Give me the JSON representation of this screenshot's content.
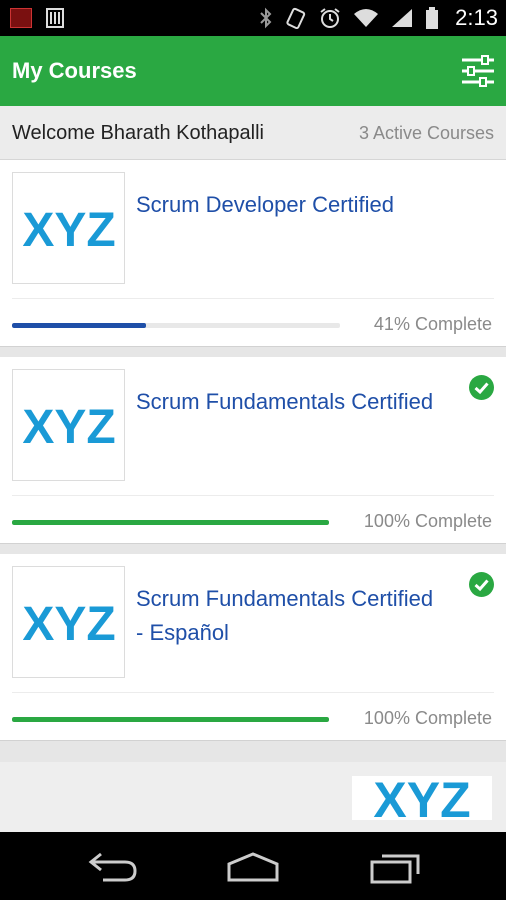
{
  "status_bar": {
    "time": "2:13",
    "left_icons": [
      "app-notification-icon",
      "barcode-notification-icon"
    ],
    "right_icons": [
      "bluetooth-icon",
      "vibrate-icon",
      "alarm-icon",
      "wifi-icon",
      "signal-icon",
      "battery-icon"
    ]
  },
  "app_bar": {
    "title": "My Courses",
    "filter_icon": "sliders-icon",
    "color": "#2aa842"
  },
  "welcome": {
    "greeting": "Welcome Bharath Kothapalli",
    "active_courses": "3 Active Courses"
  },
  "courses": [
    {
      "logo": "XYZ",
      "title": "Scrum Developer Certified",
      "progress": 0.41,
      "progress_label": "41% Complete",
      "completed": false,
      "bar_color": "#1f4fa8"
    },
    {
      "logo": "XYZ",
      "title": "Scrum Fundamentals Certified",
      "progress": 1.0,
      "progress_label": "100% Complete",
      "completed": true,
      "bar_color": "#2aa842"
    },
    {
      "logo": "XYZ",
      "title": "Scrum Fundamentals Certified - Español",
      "progress": 1.0,
      "progress_label": "100% Complete",
      "completed": true,
      "bar_color": "#2aa842"
    }
  ],
  "footer": {
    "logo": "XYZ"
  },
  "nav": {
    "icons": [
      "back-icon",
      "home-icon",
      "recent-apps-icon"
    ]
  },
  "colors": {
    "accent": "#2aa842",
    "link": "#1f4fa8",
    "logo": "#1a9ad6"
  }
}
